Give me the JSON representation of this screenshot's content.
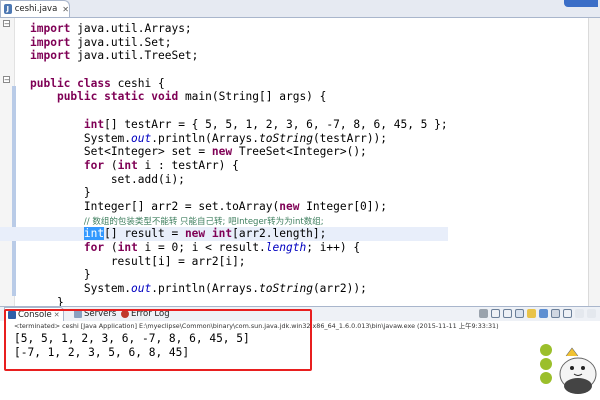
{
  "editor": {
    "tab_label": "ceshi.java",
    "lines": [
      {
        "parts": [
          {
            "c": "kw",
            "t": "import"
          },
          {
            "t": " java.util.Arrays;"
          }
        ]
      },
      {
        "parts": [
          {
            "c": "kw",
            "t": "import"
          },
          {
            "t": " java.util.Set;"
          }
        ]
      },
      {
        "parts": [
          {
            "c": "kw",
            "t": "import"
          },
          {
            "t": " java.util.TreeSet;"
          }
        ]
      },
      {
        "parts": [
          {
            "t": ""
          }
        ]
      },
      {
        "parts": [
          {
            "c": "kw",
            "t": "public class"
          },
          {
            "t": " ceshi {"
          }
        ]
      },
      {
        "parts": [
          {
            "t": "    "
          },
          {
            "c": "kw",
            "t": "public static void"
          },
          {
            "t": " main(String[] args) {"
          }
        ]
      },
      {
        "parts": [
          {
            "t": ""
          }
        ]
      },
      {
        "parts": [
          {
            "t": "        "
          },
          {
            "c": "kw",
            "t": "int"
          },
          {
            "t": "[] testArr = { 5, 5, 1, 2, 3, 6, -7, 8, 6, 45, 5 };"
          }
        ]
      },
      {
        "parts": [
          {
            "t": "        System."
          },
          {
            "c": "fld",
            "t": "out"
          },
          {
            "t": ".println(Arrays."
          },
          {
            "c": "st",
            "t": "toString"
          },
          {
            "t": "(testArr));"
          }
        ]
      },
      {
        "parts": [
          {
            "t": "        Set<Integer> set = "
          },
          {
            "c": "kw",
            "t": "new"
          },
          {
            "t": " TreeSet<Integer>();"
          }
        ]
      },
      {
        "parts": [
          {
            "t": "        "
          },
          {
            "c": "kw",
            "t": "for"
          },
          {
            "t": " ("
          },
          {
            "c": "kw",
            "t": "int"
          },
          {
            "t": " i : testArr) {"
          }
        ]
      },
      {
        "parts": [
          {
            "t": "            set.add(i);"
          }
        ]
      },
      {
        "parts": [
          {
            "t": "        }"
          }
        ]
      },
      {
        "parts": [
          {
            "t": "        Integer[] arr2 = set.toArray("
          },
          {
            "c": "kw",
            "t": "new"
          },
          {
            "t": " Integer[0]);"
          }
        ]
      },
      {
        "parts": [
          {
            "t": "        "
          },
          {
            "c": "cm",
            "t": "// 数组的包装类型不能转 只能自己转; 吧Integer转为为int数组;"
          }
        ]
      },
      {
        "hl": true,
        "parts": [
          {
            "t": "        "
          },
          {
            "c": "sel",
            "t": "int"
          },
          {
            "t": "[] result = "
          },
          {
            "c": "kw",
            "t": "new int"
          },
          {
            "t": "[arr2.length];"
          }
        ]
      },
      {
        "parts": [
          {
            "t": "        "
          },
          {
            "c": "kw",
            "t": "for"
          },
          {
            "t": " ("
          },
          {
            "c": "kw",
            "t": "int"
          },
          {
            "t": " i = 0; i < result."
          },
          {
            "c": "fld",
            "t": "length"
          },
          {
            "t": "; i++) {"
          }
        ]
      },
      {
        "parts": [
          {
            "t": "            result[i] = arr2[i];"
          }
        ]
      },
      {
        "parts": [
          {
            "t": "        }"
          }
        ]
      },
      {
        "parts": [
          {
            "t": "        System."
          },
          {
            "c": "fld",
            "t": "out"
          },
          {
            "t": ".println(Arrays."
          },
          {
            "c": "st",
            "t": "toString"
          },
          {
            "t": "(arr2));"
          }
        ]
      },
      {
        "parts": [
          {
            "t": "    }"
          }
        ]
      },
      {
        "parts": [
          {
            "t": "}"
          }
        ]
      }
    ]
  },
  "console": {
    "tabs": [
      {
        "label": "Console",
        "icon": "console-icon"
      },
      {
        "label": "Servers",
        "icon": "servers-icon"
      },
      {
        "label": "Error Log",
        "icon": "error-log-icon"
      }
    ],
    "terminated": "<terminated> ceshi [Java Application] E:\\myeclipse\\Common\\binary\\com.sun.java.jdk.win32.x86_64_1.6.0.013\\bin\\javaw.exe (2015-11-11 上午9:33:31)",
    "output": [
      "[5, 5, 1, 2, 3, 6, -7, 8, 6, 45, 5]",
      "[-7, 1, 2, 3, 5, 6, 8, 45]"
    ]
  },
  "colors": {
    "highlight_box": "#e81f1f",
    "keyword": "#7f0055",
    "comment": "#3f7f5f"
  }
}
